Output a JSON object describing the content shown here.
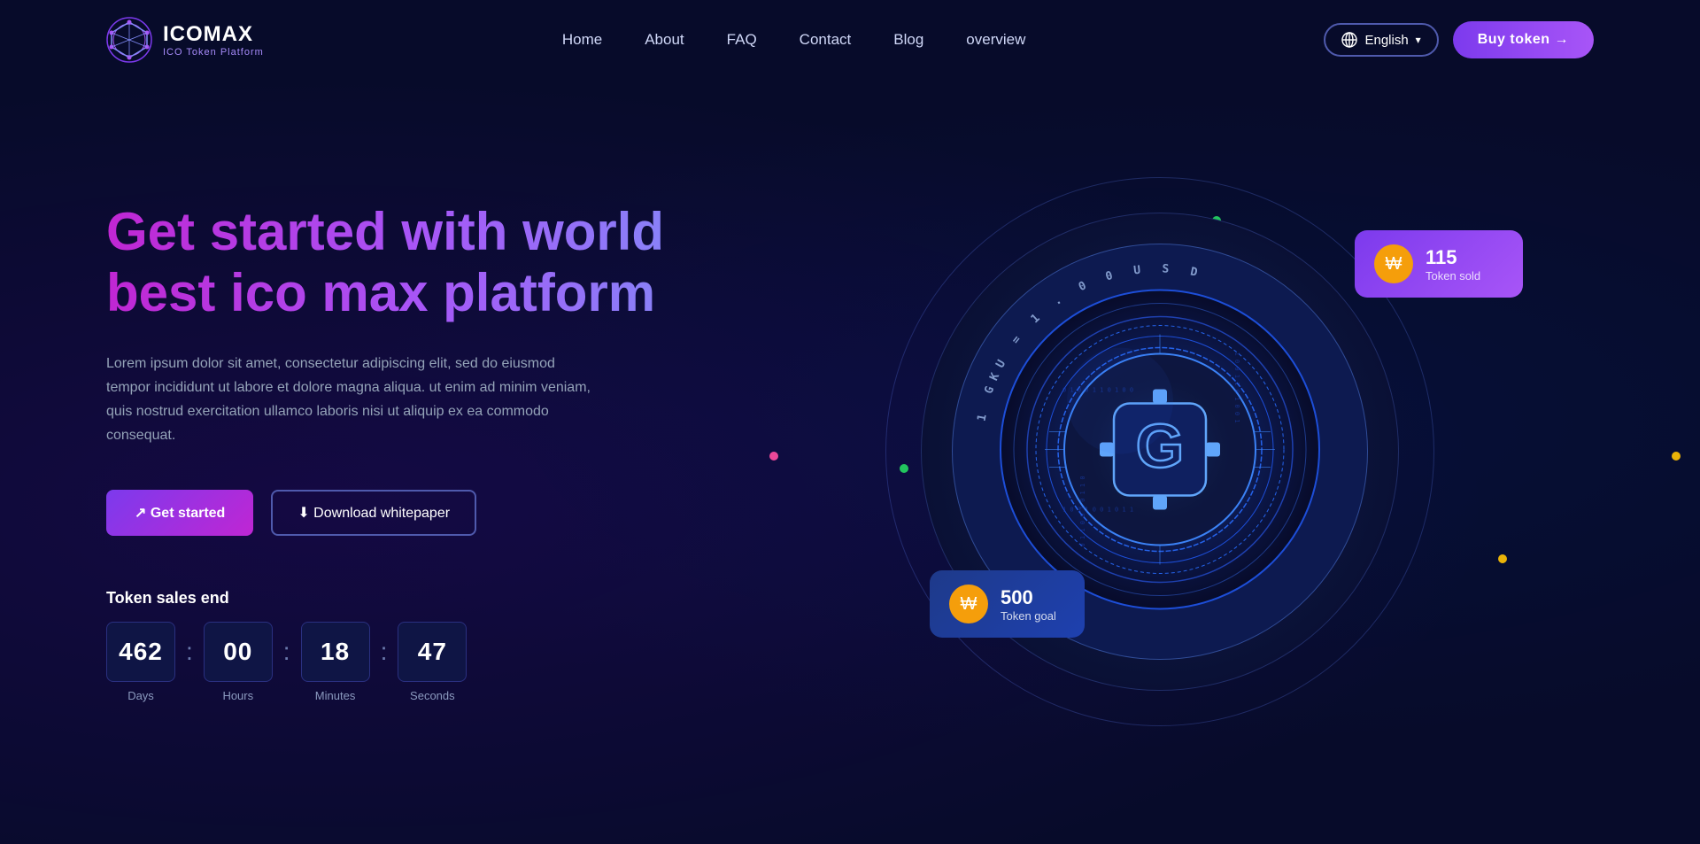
{
  "brand": {
    "name": "ICOMAX",
    "subtitle": "ICO Token Platform"
  },
  "navbar": {
    "links": [
      {
        "label": "Home",
        "id": "home"
      },
      {
        "label": "About",
        "id": "about"
      },
      {
        "label": "FAQ",
        "id": "faq"
      },
      {
        "label": "Contact",
        "id": "contact"
      },
      {
        "label": "Blog",
        "id": "blog"
      },
      {
        "label": "overview",
        "id": "overview"
      }
    ],
    "language": "English",
    "buy_button": "Buy token →"
  },
  "hero": {
    "title": "Get started with world best ico max platform",
    "description": "Lorem ipsum dolor sit amet, consectetur adipiscing elit, sed do eiusmod tempor incididunt ut labore et dolore magna aliqua. ut enim ad minim veniam, quis nostrud exercitation ullamco laboris nisi ut aliquip ex ea commodo consequat.",
    "get_started": "↗ Get started",
    "download": "⬇ Download whitepaper"
  },
  "countdown": {
    "label": "Token sales end",
    "days": {
      "value": "462",
      "unit": "Days"
    },
    "hours": {
      "value": "00",
      "unit": "Hours"
    },
    "minutes": {
      "value": "18",
      "unit": "Minutes"
    },
    "seconds": {
      "value": "47",
      "unit": "Seconds"
    }
  },
  "cards": {
    "token_sold": {
      "number": "115",
      "label": "Token sold"
    },
    "token_goal": {
      "number": "500",
      "label": "Token goal"
    }
  },
  "coin": {
    "arc_text": "1 GKU = 1.00 USD"
  },
  "colors": {
    "accent_purple": "#7c3aed",
    "accent_pink": "#c026d3",
    "bg_dark": "#070b2a",
    "bg_card": "#0f1545"
  }
}
